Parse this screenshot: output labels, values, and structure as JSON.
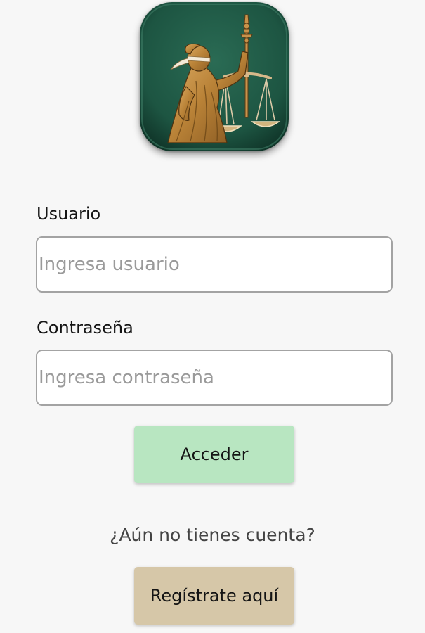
{
  "logo": {
    "icon": "lady-justice-icon",
    "colors": {
      "background": "#1d5542",
      "figure": "#c08a42"
    }
  },
  "username": {
    "label": "Usuario",
    "placeholder": "Ingresa usuario",
    "value": ""
  },
  "password": {
    "label": "Contraseña",
    "placeholder": "Ingresa contraseña",
    "value": ""
  },
  "login_button": {
    "label": "Acceder",
    "color": "#b8e6c1"
  },
  "signup_prompt": "¿Aún no tienes cuenta?",
  "register_button": {
    "label": "Regístrate aquí",
    "color": "#d6c7a8"
  }
}
